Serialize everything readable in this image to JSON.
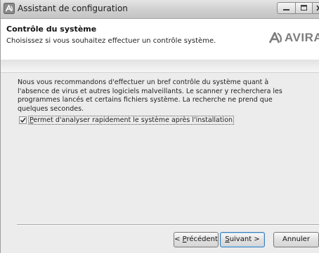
{
  "window": {
    "title": "Assistant de configuration",
    "controls": [
      "minimize-icon",
      "maximize-icon",
      "close-icon"
    ]
  },
  "header": {
    "title": "Contrôle du système",
    "subtitle": "Choisissez si vous souhaitez effectuer un contrôle système.",
    "logo_text": "AVIRA"
  },
  "body": {
    "intro": "Nous vous recommandons d'effectuer un bref contrôle du système quant à l'absence de virus et autres logiciels malveillants. Le scanner y recherchera les programmes lancés et certains fichiers système. La recherche ne prend que quelques secondes.",
    "checkbox": {
      "checked": true,
      "label_mnemonic": "P",
      "label_rest": "ermet d'analyser rapidement le système après l'installation"
    }
  },
  "footer": {
    "prev": {
      "prefix": "< ",
      "mnemonic": "P",
      "rest": "récédent"
    },
    "next": {
      "mnemonic": "S",
      "rest": "uivant >"
    },
    "cancel": "Annuler"
  },
  "colors": {
    "logo": "#7d7d7d",
    "default_button_border": "#3f7fb8"
  }
}
